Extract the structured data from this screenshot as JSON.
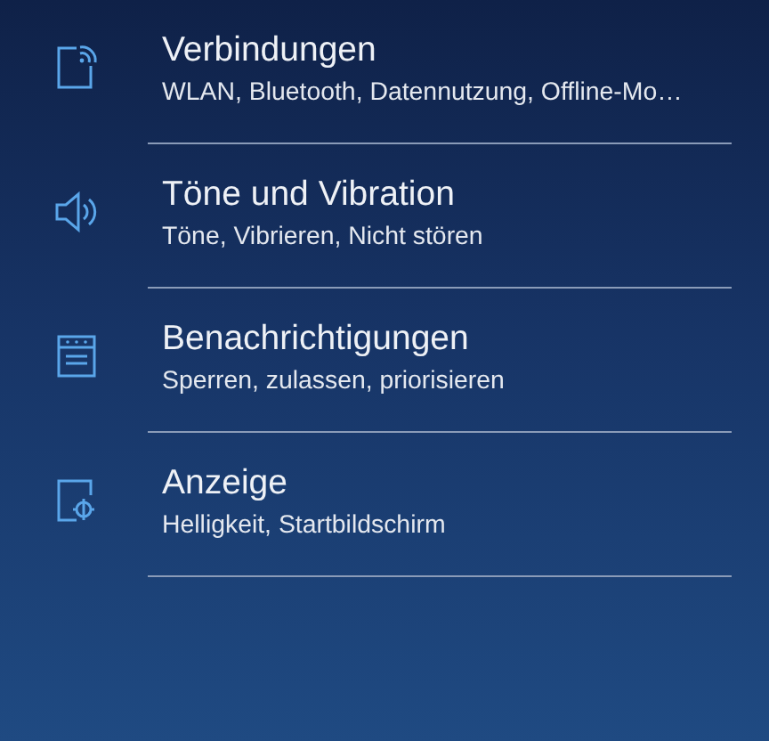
{
  "settings_items": [
    {
      "kind": "connections",
      "title": "Verbindungen",
      "subtitle": "WLAN, Bluetooth, Datennutzung, Offline-Mo…"
    },
    {
      "kind": "sound",
      "title": "Töne und Vibration",
      "subtitle": "Töne, Vibrieren, Nicht stören"
    },
    {
      "kind": "notifications",
      "title": "Benachrichtigungen",
      "subtitle": "Sperren, zulassen, priorisieren"
    },
    {
      "kind": "display",
      "title": "Anzeige",
      "subtitle": "Helligkeit, Startbildschirm"
    }
  ]
}
